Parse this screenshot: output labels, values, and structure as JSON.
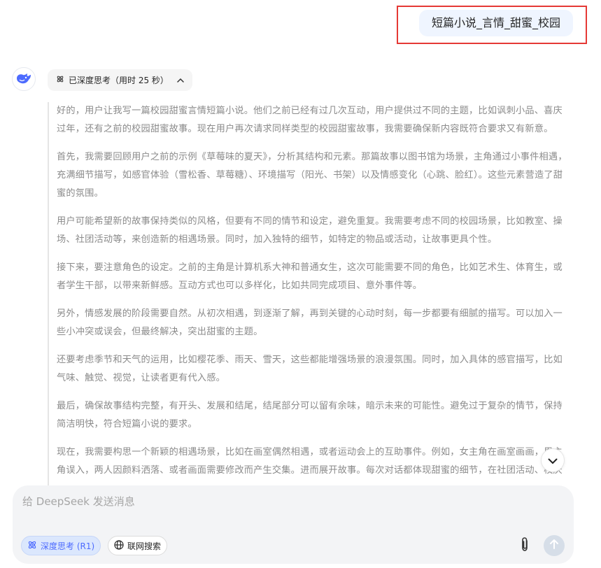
{
  "user_message": {
    "text": "短篇小说_言情_甜蜜_校园"
  },
  "thinking": {
    "label": "已深度思考（用时 25 秒）",
    "paragraphs": [
      "好的，用户让我写一篇校园甜蜜言情短篇小说。他们之前已经有过几次互动，用户提供过不同的主题，比如讽刺小品、喜庆过年，还有之前的校园甜蜜故事。现在用户再次请求同样类型的校园甜蜜故事，我需要确保新内容既符合要求又有新意。",
      "首先，我需要回顾用户之前的示例《草莓味的夏天》，分析其结构和元素。那篇故事以图书馆为场景，主角通过小事件相遇，充满细节描写，如感官体验（雪松香、草莓糖）、环境描写（阳光、书架）以及情感变化（心跳、脸红）。这些元素营造了甜蜜的氛围。",
      "用户可能希望新的故事保持类似的风格，但要有不同的情节和设定，避免重复。我需要考虑不同的校园场景，比如教室、操场、社团活动等，来创造新的相遇场景。同时，加入独特的细节，如特定的物品或活动，让故事更具个性。",
      "接下来，要注意角色的设定。之前的主角是计算机系大神和普通女生，这次可能需要不同的角色，比如艺术生、体育生，或者学生干部，以带来新鲜感。互动方式也可以多样化，比如共同完成项目、意外事件等。",
      "另外，情感发展的阶段需要自然。从初次相遇，到逐渐了解，再到关键的心动时刻，每一步都要有细腻的描写。可以加入一些小冲突或误会，但最终解决，突出甜蜜的主题。",
      "还要考虑季节和天气的运用，比如樱花季、雨天、雪天，这些都能增强场景的浪漫氛围。同时，加入具体的感官描写，比如气味、触觉、视觉，让读者更有代入感。",
      "最后，确保故事结构完整，有开头、发展和结尾，结尾部分可以留有余味，暗示未来的可能性。避免过于复杂的情节，保持简洁明快，符合短篇小说的要求。",
      "现在，我需要构思一个新颖的相遇场景，比如在画室偶然相遇，或者运动会上的互助事件。例如，女主角在画室画画，男主角误入，两人因颜料洒落、或者画面需要修改而产生交集。进而展开故事。每次对话都体现甜蜜的细节，在社团活动、校庆"
    ]
  },
  "input": {
    "placeholder": "给 DeepSeek 发送消息"
  },
  "buttons": {
    "deep_think": "深度思考 (R1)",
    "web_search": "联网搜索"
  },
  "colors": {
    "accent": "#4d6bfe",
    "highlight_border": "#e53935",
    "user_bubble": "#eff5ff"
  }
}
